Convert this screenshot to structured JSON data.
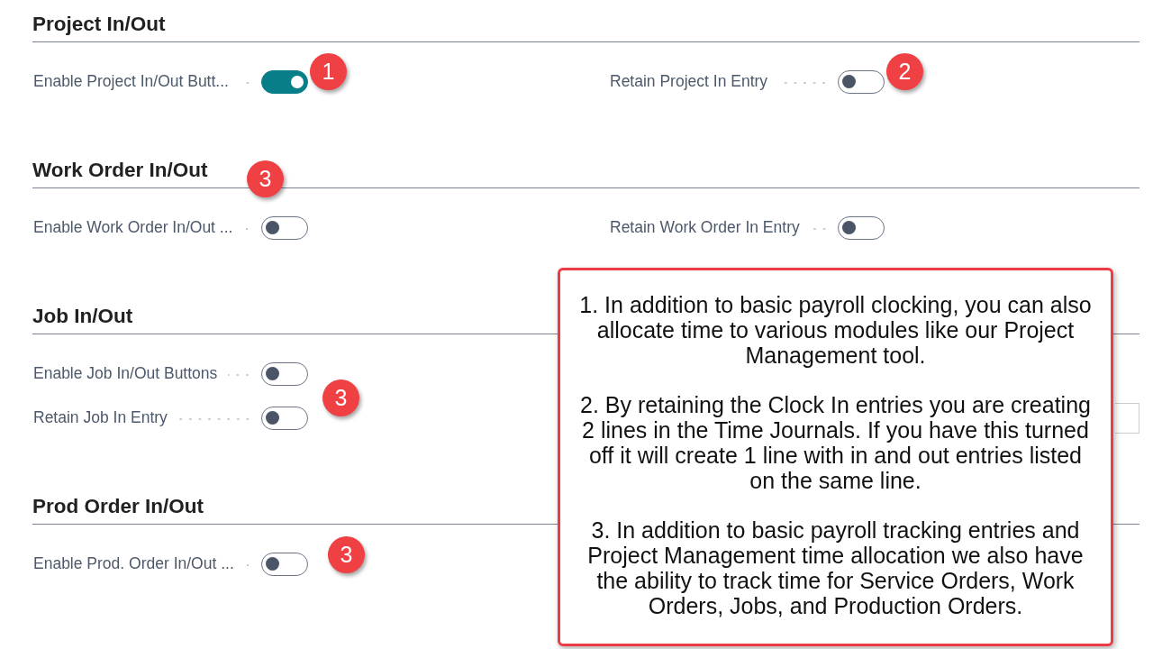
{
  "sections": [
    {
      "title": "Project In/Out",
      "columns": [
        [
          {
            "kind": "toggle",
            "label": "Enable Project In/Out Butt...",
            "on": true
          }
        ],
        [
          {
            "kind": "toggle",
            "label": "Retain Project In Entry",
            "on": false
          }
        ]
      ]
    },
    {
      "title": "Work Order In/Out",
      "columns": [
        [
          {
            "kind": "toggle",
            "label": "Enable Work Order In/Out ...",
            "on": false
          }
        ],
        [
          {
            "kind": "toggle",
            "label": "Retain Work Order In Entry",
            "on": false
          }
        ]
      ]
    },
    {
      "title": "Job In/Out",
      "columns": [
        [
          {
            "kind": "toggle",
            "label": "Enable Job In/Out Buttons",
            "on": false
          },
          {
            "kind": "toggle",
            "label": "Retain Job In Entry",
            "on": false
          }
        ],
        [
          {
            "kind": "input"
          }
        ]
      ]
    },
    {
      "title": "Prod Order In/Out",
      "columns": [
        [
          {
            "kind": "toggle",
            "label": "Enable Prod. Order In/Out ...",
            "on": false
          }
        ]
      ]
    }
  ],
  "annotation_badges": [
    {
      "number": "1"
    },
    {
      "number": "2"
    },
    {
      "number": "3"
    },
    {
      "number": "3"
    },
    {
      "number": "3"
    }
  ],
  "callout": {
    "paragraphs": [
      "1. In addition to basic payroll clocking, you can also allocate time to various modules like our Project Management tool.",
      "2. By retaining the Clock In entries you are creating 2 lines in the Time Journals. If you have this turned off it will create 1 line with in and out entries listed on the same line.",
      "3. In addition to basic payroll tracking entries and Project Management time allocation we also have the ability to track time for Service Orders, Work Orders, Jobs, and Production Orders."
    ]
  }
}
